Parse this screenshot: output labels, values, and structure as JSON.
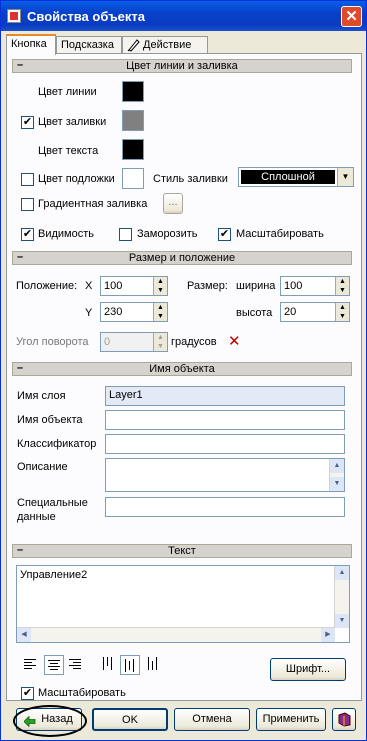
{
  "window": {
    "title": "Свойства объекта",
    "close": "✕"
  },
  "tabs": [
    "Кнопка",
    "Подсказка",
    "Действие"
  ],
  "sections": {
    "line_fill": "Цвет линии и заливка",
    "size_pos": "Размер и положение",
    "name": "Имя объекта",
    "text": "Текст"
  },
  "section_toggle": "–",
  "colors": {
    "line_label": "Цвет линии",
    "line_color": "#000000",
    "fill_label": "Цвет заливки",
    "fill_color": "#808080",
    "fill_checked": true,
    "text_label": "Цвет текста",
    "text_color": "#000000",
    "backing_label": "Цвет подложки",
    "backing_color": "#ffffff",
    "backing_checked": false,
    "fill_style_label": "Стиль заливки",
    "fill_style_value": "Сплошной",
    "gradient_label": "Градиентная заливка",
    "gradient_checked": false,
    "gradient_button": "..."
  },
  "flags": {
    "visible_label": "Видимость",
    "visible_checked": true,
    "freeze_label": "Заморозить",
    "freeze_checked": false,
    "scale_label": "Масштабировать",
    "scale_checked": true
  },
  "position": {
    "label": "Положение:",
    "x_label": "X",
    "x_value": "100",
    "y_label": "Y",
    "y_value": "230",
    "size_label": "Размер:",
    "width_label": "ширина",
    "width_value": "100",
    "height_label": "высота",
    "height_value": "20",
    "rotation_label": "Угол поворота",
    "rotation_value": "0",
    "degrees_label": "градусов",
    "reset_icon": "✕"
  },
  "name_fields": {
    "layer_label": "Имя слоя",
    "layer_value": "Layer1",
    "object_label": "Имя объекта",
    "object_value": "",
    "classifier_label": "Классификатор",
    "classifier_value": "",
    "description_label": "Описание",
    "description_value": "",
    "special_label": "Специальные данные",
    "special_value": ""
  },
  "text": {
    "content": "Управление2",
    "font_button": "Шрифт...",
    "scale_label": "Масштабировать",
    "scale_checked": true
  },
  "buttons": {
    "back": "Назад",
    "ok": "OK",
    "cancel": "Отмена",
    "apply": "Применить"
  },
  "check_mark": "✔",
  "spin_up": "▲",
  "spin_down": "▼",
  "combo_arrow": "▼"
}
